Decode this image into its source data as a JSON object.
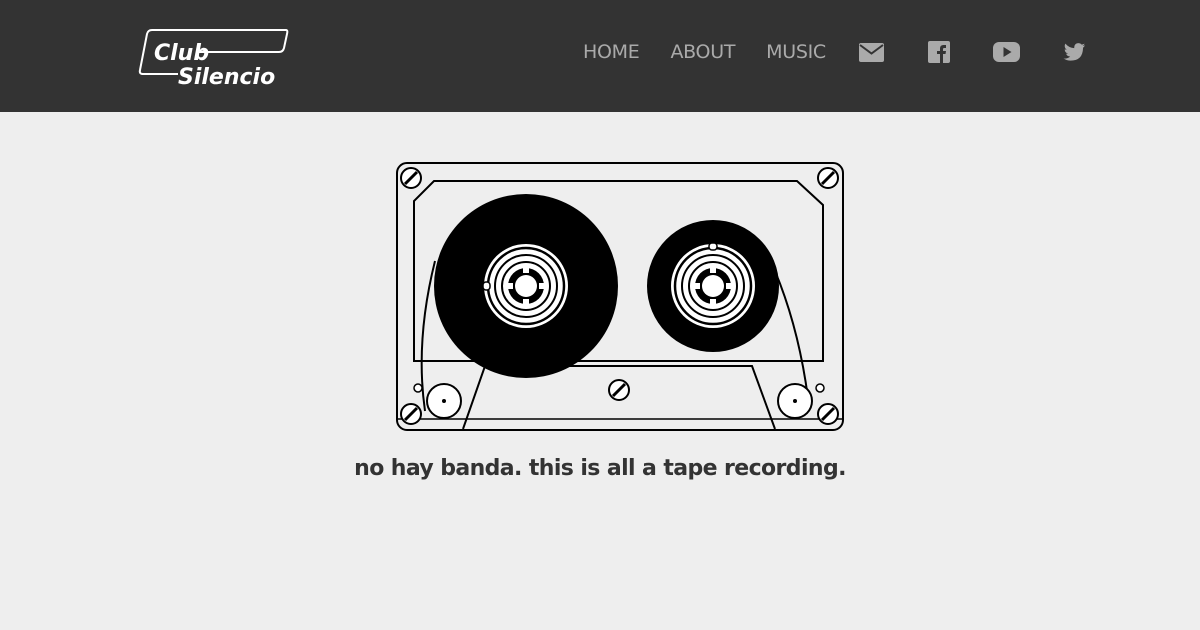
{
  "header": {
    "logo": {
      "line1": "Club",
      "line2": "Silencio"
    },
    "nav": [
      {
        "label": "HOME"
      },
      {
        "label": "ABOUT"
      },
      {
        "label": "MUSIC"
      }
    ],
    "social_icons": [
      "envelope-icon",
      "facebook-icon",
      "youtube-icon",
      "twitter-icon"
    ]
  },
  "main": {
    "illustration": "cassette-tape",
    "tagline": "no hay banda. this is all a tape recording."
  },
  "colors": {
    "header_bg": "#333333",
    "page_bg": "#eeeeee",
    "nav_text": "#aaaaaa",
    "tagline_text": "#333333"
  }
}
